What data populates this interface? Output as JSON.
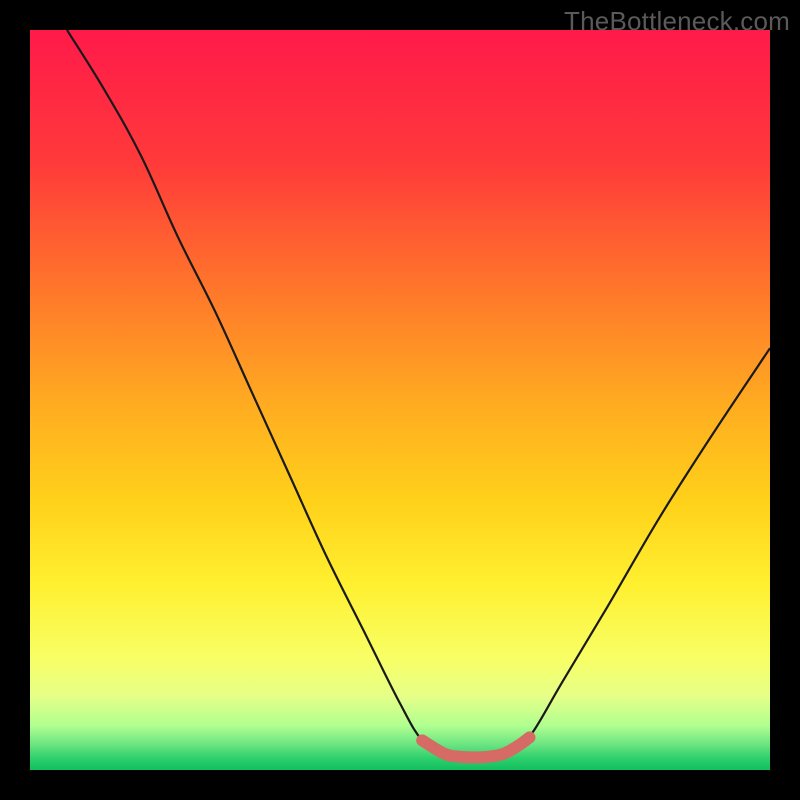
{
  "watermark": {
    "text": "TheBottleneck.com"
  },
  "colors": {
    "page_bg": "#000000",
    "watermark": "#5a5a5a",
    "gradient_stops": [
      {
        "offset": 0,
        "color": "#ff1a4a"
      },
      {
        "offset": 0.18,
        "color": "#ff3a3a"
      },
      {
        "offset": 0.36,
        "color": "#ff7a2a"
      },
      {
        "offset": 0.52,
        "color": "#ffb020"
      },
      {
        "offset": 0.64,
        "color": "#ffd21a"
      },
      {
        "offset": 0.75,
        "color": "#fff030"
      },
      {
        "offset": 0.85,
        "color": "#f8ff66"
      },
      {
        "offset": 0.9,
        "color": "#e6ff88"
      },
      {
        "offset": 0.94,
        "color": "#b0ff90"
      },
      {
        "offset": 0.965,
        "color": "#6de582"
      },
      {
        "offset": 0.985,
        "color": "#2bcf6b"
      },
      {
        "offset": 1,
        "color": "#13bf60"
      }
    ],
    "main_curve": "#1a1a1a",
    "highlight": "#d66a64"
  },
  "chart_data": {
    "type": "line",
    "title": "",
    "xlabel": "",
    "ylabel": "",
    "xlim": [
      0,
      100
    ],
    "ylim": [
      0,
      100
    ],
    "grid": false,
    "legend": false,
    "annotations": [],
    "series": [
      {
        "name": "bottleneck-curve",
        "stroke": "main_curve",
        "stroke_width": 2.2,
        "points": [
          {
            "x": 5,
            "y": 100
          },
          {
            "x": 10,
            "y": 92
          },
          {
            "x": 15,
            "y": 83
          },
          {
            "x": 20,
            "y": 72
          },
          {
            "x": 25,
            "y": 62
          },
          {
            "x": 30,
            "y": 51
          },
          {
            "x": 35,
            "y": 40
          },
          {
            "x": 40,
            "y": 29
          },
          {
            "x": 45,
            "y": 19
          },
          {
            "x": 50,
            "y": 9
          },
          {
            "x": 53,
            "y": 4
          },
          {
            "x": 56,
            "y": 2.2
          },
          {
            "x": 58,
            "y": 1.8
          },
          {
            "x": 60,
            "y": 1.7
          },
          {
            "x": 62,
            "y": 1.8
          },
          {
            "x": 64,
            "y": 2.2
          },
          {
            "x": 66,
            "y": 3.3
          },
          {
            "x": 68,
            "y": 5.2
          },
          {
            "x": 72,
            "y": 12
          },
          {
            "x": 78,
            "y": 22
          },
          {
            "x": 85,
            "y": 34
          },
          {
            "x": 92,
            "y": 45
          },
          {
            "x": 100,
            "y": 57
          }
        ]
      },
      {
        "name": "highlight-segment",
        "stroke": "highlight",
        "stroke_width": 12,
        "linecap": "round",
        "points": [
          {
            "x": 53,
            "y": 4
          },
          {
            "x": 56,
            "y": 2.2
          },
          {
            "x": 58,
            "y": 1.8
          },
          {
            "x": 60,
            "y": 1.7
          },
          {
            "x": 62,
            "y": 1.8
          },
          {
            "x": 64,
            "y": 2.2
          },
          {
            "x": 66,
            "y": 3.3
          },
          {
            "x": 67.5,
            "y": 4.4
          }
        ]
      }
    ]
  }
}
